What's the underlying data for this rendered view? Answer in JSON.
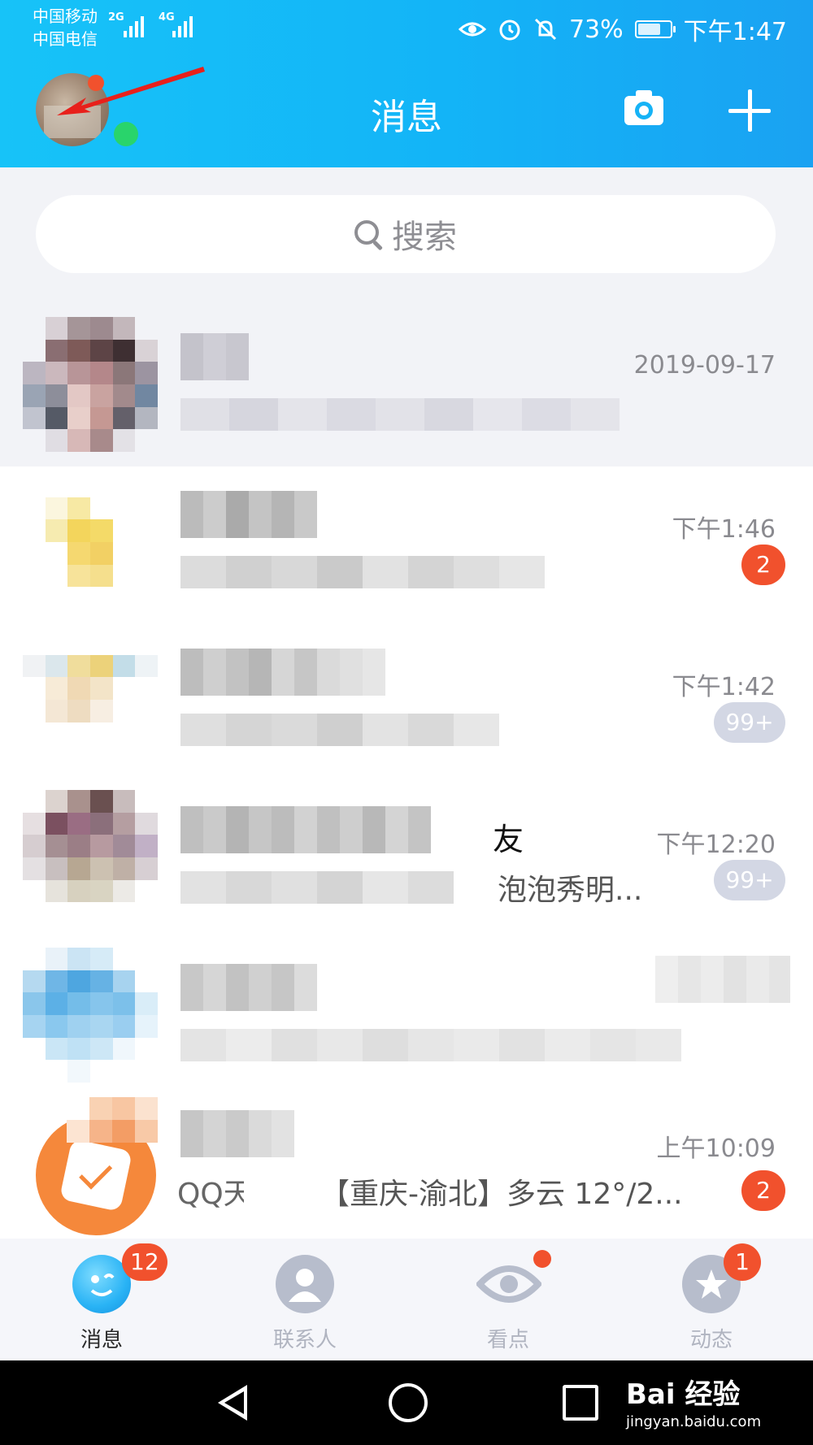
{
  "status_bar": {
    "carrier_1": "中国移动",
    "carrier_2": "中国电信",
    "net_1": "2G",
    "net_2": "4G",
    "battery_percent": "73%",
    "battery_level": 0.73,
    "time": "下午1:47",
    "icons": [
      "eye-icon",
      "alarm-icon",
      "mute-bell-icon",
      "battery-icon"
    ]
  },
  "header": {
    "title": "消息",
    "camera_icon": "camera-icon",
    "add_icon": "plus-icon"
  },
  "search": {
    "placeholder": "搜索"
  },
  "conversations": [
    {
      "time": "2019-09-17"
    },
    {
      "time": "下午1:46",
      "badge": "2"
    },
    {
      "time": "下午1:42",
      "badge": "99+"
    },
    {
      "time": "下午12:20",
      "badge": "99+",
      "name_partial": "友",
      "snippet_partial": "泡泡秀明..."
    },
    {},
    {
      "name_partial": "QQ天",
      "time": "上午10:09",
      "badge": "2",
      "snippet": "【重庆-渝北】多云 12°/2..."
    }
  ],
  "tabs": [
    {
      "label": "消息",
      "badge": "12",
      "icon": "chat-bubble-icon"
    },
    {
      "label": "联系人",
      "icon": "contacts-icon"
    },
    {
      "label": "看点",
      "icon": "eye-watch-icon"
    },
    {
      "label": "动态",
      "badge": "1",
      "icon": "planet-icon"
    }
  ],
  "watermark": {
    "main": "Bai 经验",
    "sub": "jingyan.baidu.com"
  },
  "colors": {
    "header": "#13b4f7",
    "badge": "#f1512d",
    "online": "#29d46b"
  }
}
